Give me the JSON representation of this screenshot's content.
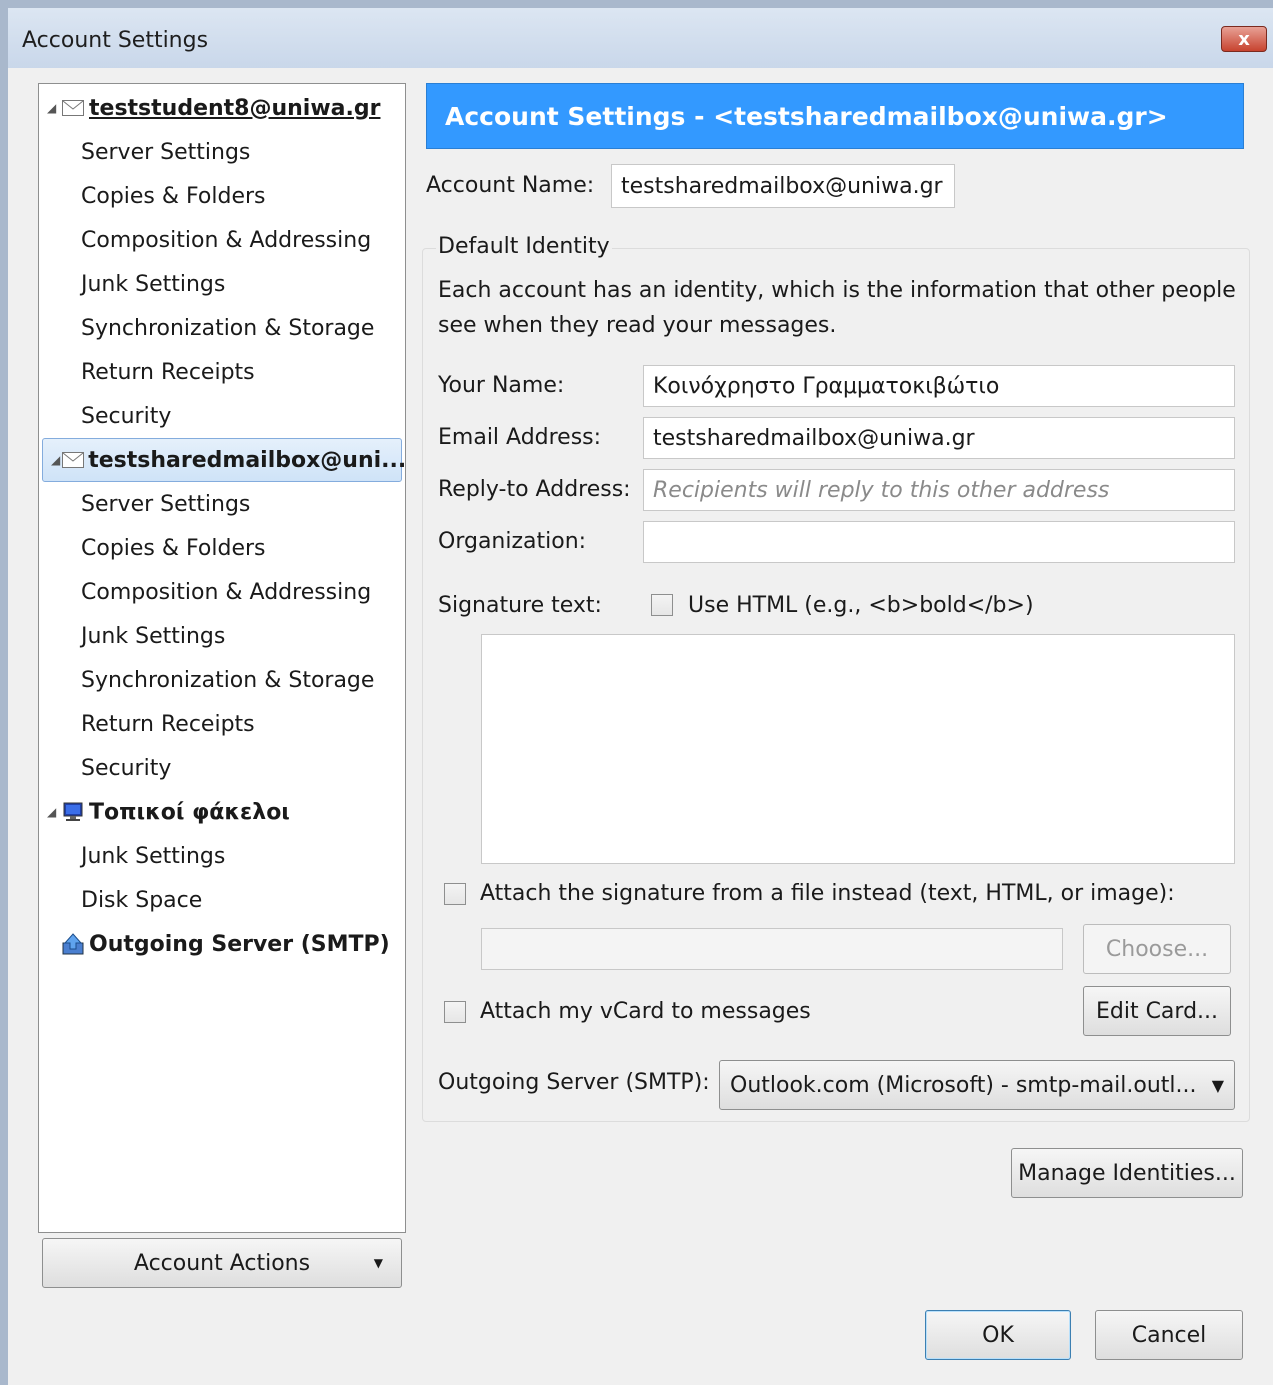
{
  "window": {
    "title": "Account Settings",
    "close_label": "x"
  },
  "tree": {
    "items": [
      {
        "label": "teststudent8@uniwa.gr",
        "kind": "account"
      },
      {
        "label": "Server Settings"
      },
      {
        "label": "Copies & Folders"
      },
      {
        "label": "Composition & Addressing"
      },
      {
        "label": "Junk Settings"
      },
      {
        "label": "Synchronization & Storage"
      },
      {
        "label": "Return Receipts"
      },
      {
        "label": "Security"
      },
      {
        "label": "testsharedmailbox@uni...",
        "kind": "account",
        "selected": true
      },
      {
        "label": "Server Settings"
      },
      {
        "label": "Copies & Folders"
      },
      {
        "label": "Composition & Addressing"
      },
      {
        "label": "Junk Settings"
      },
      {
        "label": "Synchronization & Storage"
      },
      {
        "label": "Return Receipts"
      },
      {
        "label": "Security"
      },
      {
        "label": "Τοπικοί φάκελοι",
        "kind": "local"
      },
      {
        "label": "Junk Settings"
      },
      {
        "label": "Disk Space"
      },
      {
        "label": "Outgoing Server (SMTP)",
        "kind": "smtp"
      }
    ],
    "account_actions_label": "Account Actions"
  },
  "main": {
    "header": "Account Settings - <testsharedmailbox@uniwa.gr>",
    "account_name_label": "Account Name:",
    "account_name_value": "testsharedmailbox@uniwa.gr",
    "identity": {
      "legend": "Default Identity",
      "description_line1": "Each account has an identity, which is the information that other people",
      "description_line2": "see when they read your messages.",
      "your_name_label": "Your Name:",
      "your_name_value": "Κοινόχρηστο Γραμματοκιβώτιο",
      "email_label": "Email Address:",
      "email_value": "testsharedmailbox@uniwa.gr",
      "reply_to_label": "Reply-to Address:",
      "reply_to_placeholder": "Recipients will reply to this other address",
      "organization_label": "Organization:",
      "organization_value": "",
      "signature_label": "Signature text:",
      "use_html_label": "Use HTML (e.g., <b>bold</b>)",
      "use_html_checked": false,
      "signature_text": "",
      "attach_file_label": "Attach the signature from a file instead (text, HTML, or image):",
      "attach_file_checked": false,
      "attach_file_path": "",
      "choose_label": "Choose...",
      "attach_vcard_label": "Attach my vCard to messages",
      "attach_vcard_checked": false,
      "edit_card_label": "Edit Card...",
      "smtp_label": "Outgoing Server (SMTP):",
      "smtp_value": "Outlook.com (Microsoft) - smtp-mail.outl..."
    },
    "manage_identities_label": "Manage Identities...",
    "ok_label": "OK",
    "cancel_label": "Cancel"
  }
}
